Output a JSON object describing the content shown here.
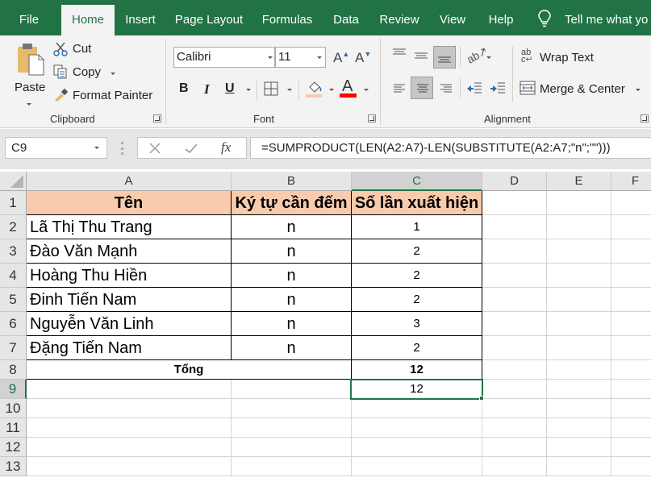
{
  "ribbon_tabs": [
    "File",
    "Home",
    "Insert",
    "Page Layout",
    "Formulas",
    "Data",
    "Review",
    "View",
    "Help"
  ],
  "active_tab": "Home",
  "tell_me": "Tell me what yo",
  "clipboard": {
    "paste": "Paste",
    "cut": "Cut",
    "copy": "Copy",
    "format_painter": "Format Painter",
    "label": "Clipboard"
  },
  "font": {
    "name": "Calibri",
    "size": "11",
    "bold": "B",
    "italic": "I",
    "underline": "U",
    "font_color_letter": "A",
    "label": "Font",
    "fill_color": "#f8cbad",
    "font_color": "#ff0000"
  },
  "alignment": {
    "wrap_text": "Wrap Text",
    "merge_center": "Merge & Center",
    "label": "Alignment"
  },
  "formula_bar": {
    "name_box": "C9",
    "fx": "fx",
    "formula": "=SUMPRODUCT(LEN(A2:A7)-LEN(SUBSTITUTE(A2:A7;\"n\";\"\")))"
  },
  "columns": [
    "A",
    "B",
    "C",
    "D",
    "E",
    "F"
  ],
  "rows": [
    "1",
    "2",
    "3",
    "4",
    "5",
    "6",
    "7",
    "8",
    "9",
    "10",
    "11",
    "12",
    "13"
  ],
  "table": {
    "headers": [
      "Tên",
      "Ký tự cần đếm",
      "Số lần xuất hiện"
    ],
    "rows": [
      {
        "name": "Lã Thị Thu Trang",
        "char": "n",
        "count": "1"
      },
      {
        "name": "Đào Văn Mạnh",
        "char": "n",
        "count": "2"
      },
      {
        "name": "Hoàng Thu Hiền",
        "char": "n",
        "count": "2"
      },
      {
        "name": "Đinh Tiến Nam",
        "char": "n",
        "count": "2"
      },
      {
        "name": "Nguyễn Văn Linh",
        "char": "n",
        "count": "3"
      },
      {
        "name": "Đặng Tiến Nam",
        "char": "n",
        "count": "2"
      }
    ],
    "total_label": "Tổng",
    "total_value": "12",
    "c9_value": "12"
  },
  "colors": {
    "accent": "#217346",
    "header_fill": "#f8cbad"
  }
}
